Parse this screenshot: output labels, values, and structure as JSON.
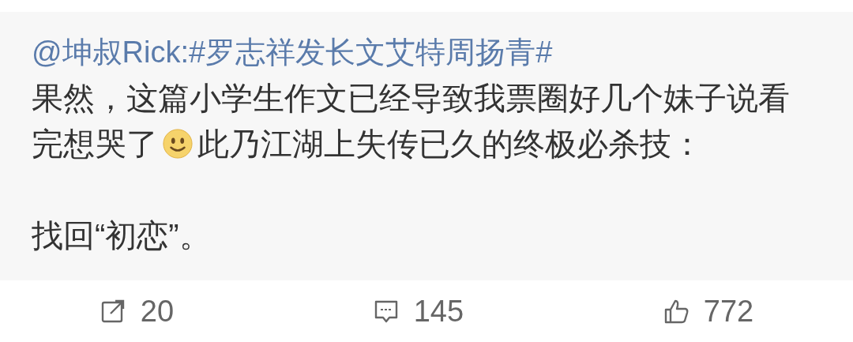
{
  "post": {
    "author": "@坤叔Rick:",
    "topic": "#罗志祥发长文艾特周扬青#",
    "line_1": "果然，这篇小学生作文已经导致我票圈好几个妹子说看",
    "line_2_before_emoji": "完想哭了",
    "line_2_after_emoji": "此乃江湖上失传已久的终极必杀技：",
    "last_line": "找回“初恋”。"
  },
  "actions": [
    {
      "kind": "repost",
      "count": "20"
    },
    {
      "kind": "comment",
      "count": "145"
    },
    {
      "kind": "like",
      "count": "772"
    }
  ]
}
